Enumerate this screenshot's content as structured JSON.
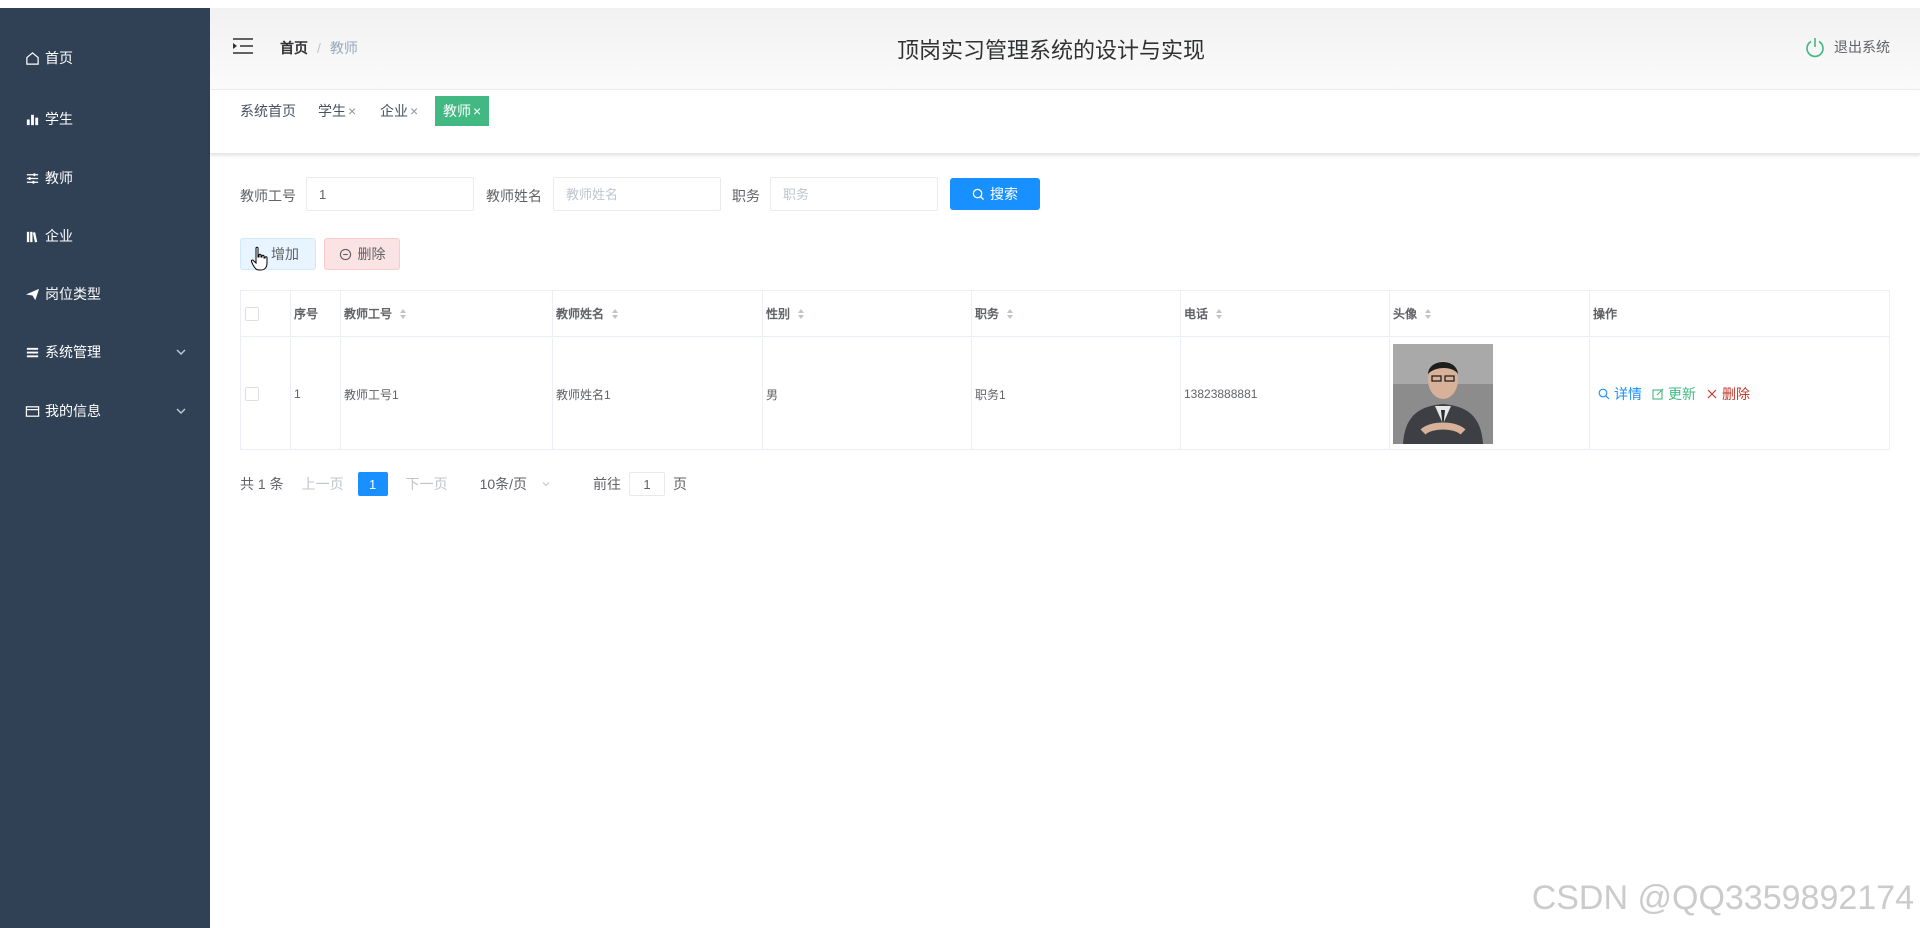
{
  "sidebar": {
    "items": [
      {
        "label": "首页",
        "icon": "home-icon"
      },
      {
        "label": "学生",
        "icon": "bar-chart-icon"
      },
      {
        "label": "教师",
        "icon": "sliders-icon"
      },
      {
        "label": "企业",
        "icon": "books-icon"
      },
      {
        "label": "岗位类型",
        "icon": "send-icon"
      },
      {
        "label": "系统管理",
        "icon": "list-icon",
        "expandable": true
      },
      {
        "label": "我的信息",
        "icon": "card-icon",
        "expandable": true
      }
    ],
    "bg_color": "#304156"
  },
  "header": {
    "breadcrumb_home": "首页",
    "breadcrumb_sep": "/",
    "breadcrumb_current": "教师",
    "title": "顶岗实习管理系统的设计与实现",
    "logout_label": "退出系统"
  },
  "tags": [
    {
      "label": "系统首页",
      "closable": false,
      "active": false
    },
    {
      "label": "学生",
      "closable": true,
      "active": false
    },
    {
      "label": "企业",
      "closable": true,
      "active": false
    },
    {
      "label": "教师",
      "closable": true,
      "active": true
    }
  ],
  "tag_close": "×",
  "search": {
    "field1_label": "教师工号",
    "field1_value": "1",
    "field2_label": "教师姓名",
    "field2_placeholder": "教师姓名",
    "field3_label": "职务",
    "field3_placeholder": "职务",
    "button_label": "搜索"
  },
  "actions": {
    "add_label": "增加",
    "delete_label": "删除"
  },
  "table": {
    "headers": [
      "序号",
      "教师工号",
      "教师姓名",
      "性别",
      "职务",
      "电话",
      "头像",
      "操作"
    ],
    "rows": [
      {
        "index": "1",
        "teacher_no": "教师工号1",
        "teacher_name": "教师姓名1",
        "gender": "男",
        "position": "职务1",
        "phone": "13823888881",
        "avatar": "teacher-photo"
      }
    ],
    "ops": {
      "detail": "详情",
      "update": "更新",
      "delete": "删除"
    }
  },
  "pagination": {
    "total": "共 1 条",
    "prev": "上一页",
    "current_page": "1",
    "next": "下一页",
    "page_size": "10条/页",
    "goto_label": "前往",
    "goto_value": "1",
    "goto_suffix": "页"
  },
  "watermark": "CSDN @QQ3359892174",
  "colors": {
    "primary": "#1890ff",
    "active_tag": "#42b983",
    "detail": "#1890ff",
    "update": "#42b983",
    "delete": "#c0392b"
  }
}
